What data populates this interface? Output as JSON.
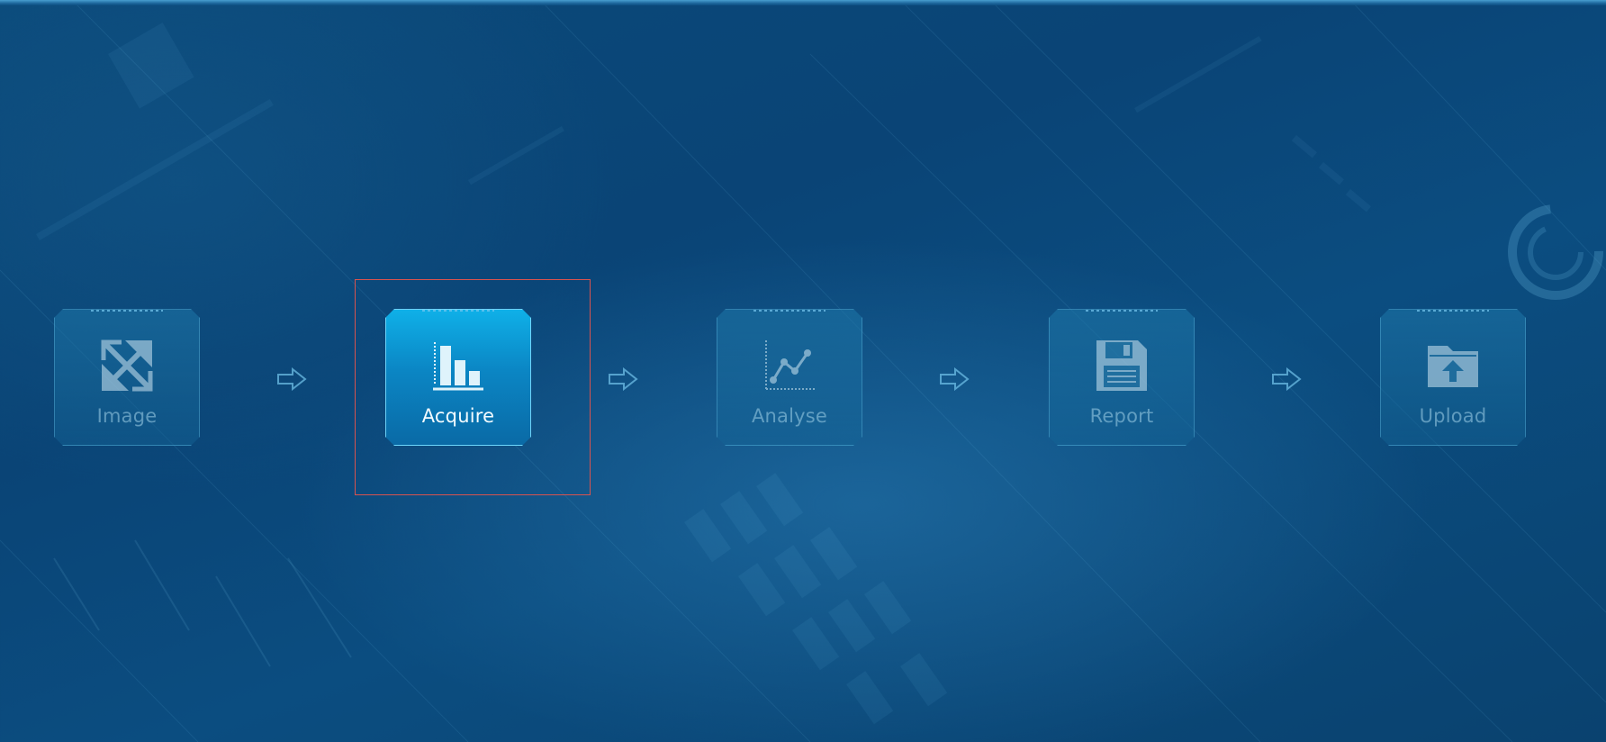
{
  "workflow": {
    "steps": [
      {
        "label": "Image",
        "icon": "expand-arrows-icon",
        "active": false
      },
      {
        "label": "Acquire",
        "icon": "bar-chart-icon",
        "active": true
      },
      {
        "label": "Analyse",
        "icon": "line-chart-icon",
        "active": false
      },
      {
        "label": "Report",
        "icon": "floppy-disk-icon",
        "active": false
      },
      {
        "label": "Upload",
        "icon": "folder-upload-icon",
        "active": false
      }
    ],
    "connector_icon": "right-arrow-icon"
  },
  "colors": {
    "background": "#0a4476",
    "active_tile": "#0b86c4",
    "inactive_tile": "#1e78aa",
    "selection_outline": "#d9534f",
    "active_text": "#f2fbff",
    "inactive_text": "#96c8e1"
  }
}
